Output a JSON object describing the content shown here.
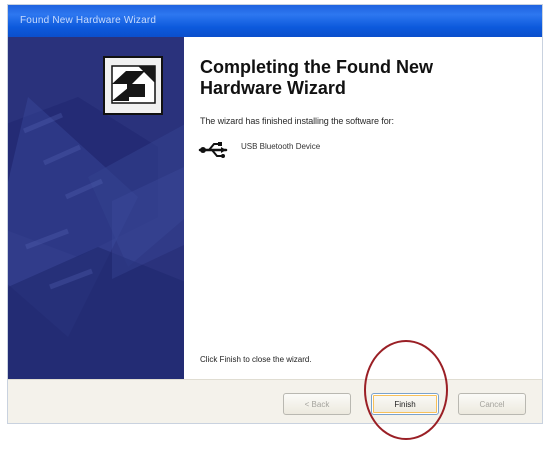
{
  "window": {
    "title": "Found New Hardware Wizard"
  },
  "icons": {
    "wizard_icon": "hardware-wizard-icon",
    "device_icon": "usb-icon"
  },
  "main": {
    "heading": "Completing the Found New\nHardware Wizard",
    "message": "The wizard has finished installing the software for:",
    "device_name": "USB Bluetooth Device",
    "close_instruction": "Click Finish to close the wizard."
  },
  "buttons": {
    "back": "< Back",
    "finish": "Finish",
    "cancel": "Cancel"
  },
  "colors": {
    "titlebar": "#0b4fcc",
    "left_panel": "#2a327c",
    "callout": "#9a1f25"
  }
}
